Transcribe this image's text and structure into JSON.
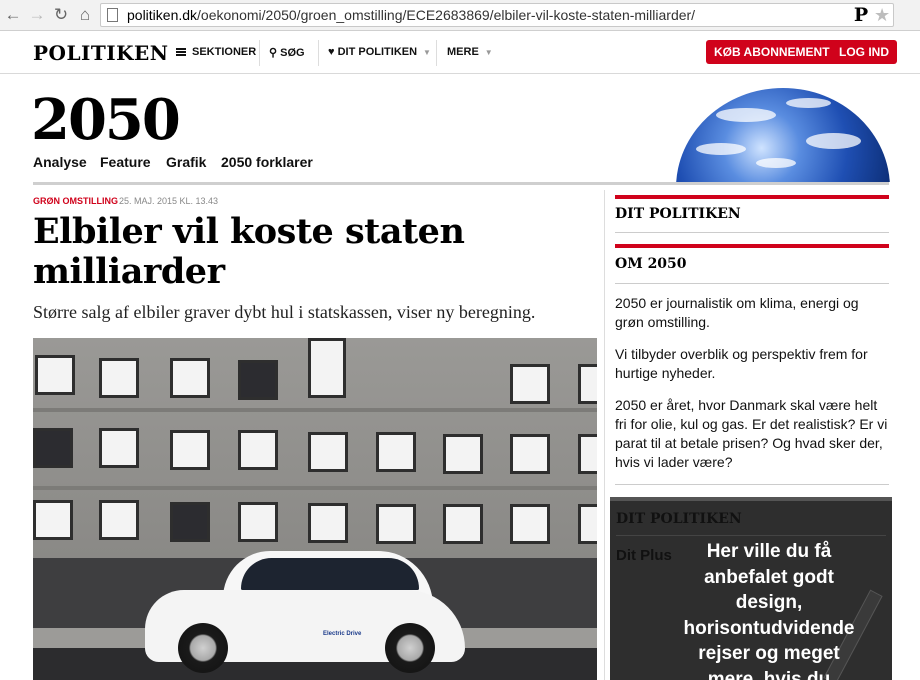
{
  "browser": {
    "url_host": "politiken.dk",
    "url_path": "/oekonomi/2050/groen_omstilling/ECE2683869/elbiler-vil-koste-staten-milliarder/",
    "back_glyph": "←",
    "forward_glyph": "→",
    "reload_glyph": "↻",
    "home_glyph": "⌂",
    "extension_letter": "P",
    "bookmark_glyph": "★"
  },
  "sitenav": {
    "logo": "POLITIKEN",
    "sections": "SEKTIONER",
    "search": "SØG",
    "search_glyph": "⚲",
    "my_politiken": "DIT POLITIKEN",
    "heart_glyph": "♥",
    "more": "MERE",
    "caret_glyph": "▼",
    "subscribe": "KØB ABONNEMENT",
    "login": "LOG IND"
  },
  "section": {
    "title": "2050",
    "tabs": [
      "Analyse",
      "Feature",
      "Grafik",
      "2050 forklarer"
    ]
  },
  "article": {
    "kicker": "GRØN OMSTILLING",
    "date": "25. MAJ. 2015 KL. 13.43",
    "headline_lines": [
      "Elbiler vil koste staten",
      "milliarder"
    ],
    "lede": "Større salg af elbiler graver dybt hul i statskassen, viser ny beregning.",
    "photo_car_badge": "Electric Drive"
  },
  "sidebar": {
    "dit_politiken": "DIT POLITIKEN",
    "om_2050": "OM 2050",
    "paragraphs": [
      "2050 er journalistik om klima, energi og grøn omstilling.",
      "Vi tilbyder overblik og perspektiv frem for hurtige nyheder.",
      "2050 er året, hvor Danmark skal være helt fri for olie, kul og gas. Er det realistisk? Er vi parat til at betale prisen? Og hvad sker der, hvis vi lader være?"
    ],
    "ad": {
      "label": "DIT POLITIKEN",
      "plus": "Dit Plus",
      "lines": [
        "Her ville du få",
        "anbefalet godt",
        "design,",
        "horisontudvidende",
        "rejser og meget",
        "mere, hvis du"
      ]
    }
  },
  "colors": {
    "accent_red": "#d0021b"
  }
}
